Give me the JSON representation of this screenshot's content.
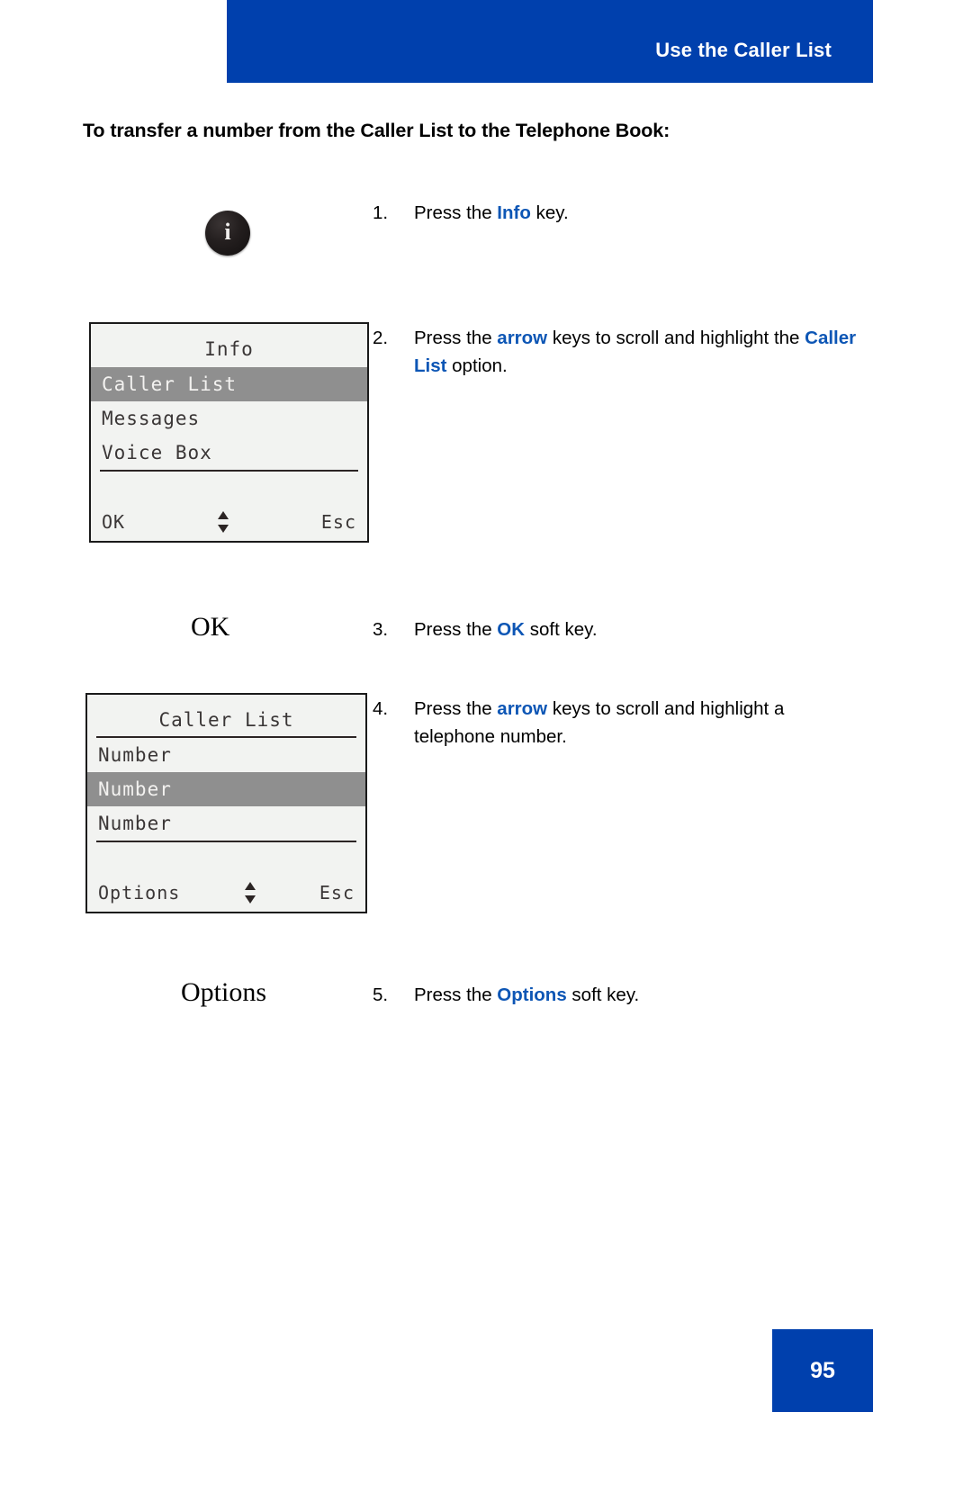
{
  "header": {
    "title": "Use the Caller List",
    "banner_color": "#0040AD"
  },
  "heading": "To transfer a number from the Caller List to the Telephone Book:",
  "accent_color": "#0D56B5",
  "steps": [
    {
      "number": "1.",
      "text_before": "Press the ",
      "keyword": "Info",
      "text_after": " key."
    },
    {
      "number": "2.",
      "text_before": "Press the ",
      "keyword": "arrow",
      "text_mid": " keys to scroll and highlight the ",
      "keyword2": "Caller List",
      "text_after": " option."
    },
    {
      "number": "3.",
      "text_before": "Press the ",
      "keyword": "OK",
      "text_after": " soft key."
    },
    {
      "number": "4.",
      "text_before": "Press the ",
      "keyword": "arrow",
      "text_after": " keys to scroll and highlight a telephone number."
    },
    {
      "number": "5.",
      "text_before": "Press the ",
      "keyword": "Options",
      "text_after": " soft key."
    }
  ],
  "info_key": {
    "glyph": "i",
    "name": "info-key"
  },
  "screen_1": {
    "title": "Info",
    "rows": [
      {
        "label": "Caller List",
        "selected": true
      },
      {
        "label": "Messages",
        "selected": false
      },
      {
        "label": "Voice Box",
        "selected": false
      }
    ],
    "softkey_left": "OK",
    "softkey_right": "Esc",
    "highlight_color": "#8F8F8F"
  },
  "screen_2": {
    "title": "Caller List",
    "rows": [
      {
        "label": "Number",
        "selected": false
      },
      {
        "label": "Number",
        "selected": true
      },
      {
        "label": "Number",
        "selected": false
      }
    ],
    "softkey_left": "Options",
    "softkey_right": "Esc",
    "highlight_color": "#8F8F8F"
  },
  "softkey_captions": {
    "ok": "OK",
    "options": "Options"
  },
  "page_number": "95"
}
